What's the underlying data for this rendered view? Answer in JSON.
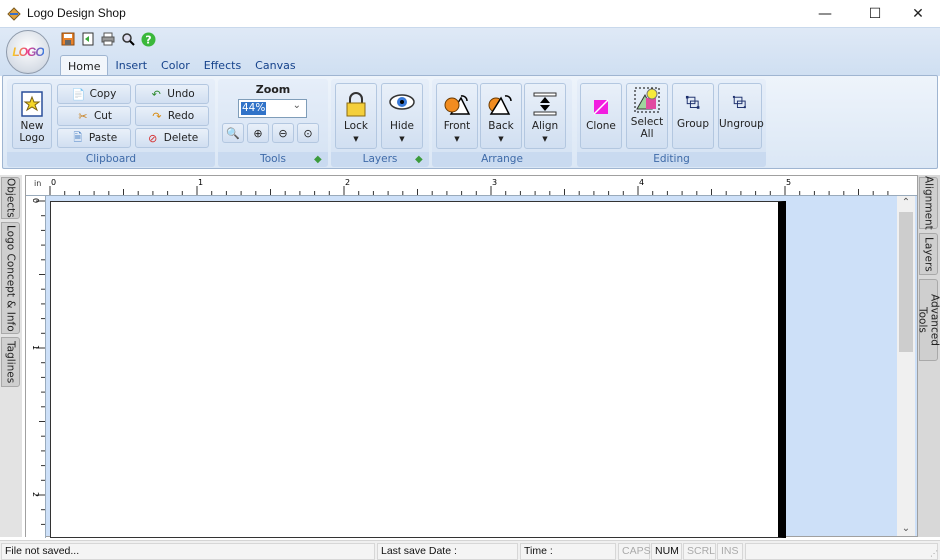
{
  "window": {
    "title": "Logo Design Shop",
    "controls": {
      "minimize": "—",
      "maximize": "☐",
      "close": "✕"
    }
  },
  "app_orb": {
    "label": "LOGO"
  },
  "quick_access": [
    {
      "name": "save-icon",
      "glyph": "💾"
    },
    {
      "name": "export-icon",
      "glyph": "📄"
    },
    {
      "name": "print-icon",
      "glyph": "🖶"
    },
    {
      "name": "preview-icon",
      "glyph": "🔍"
    },
    {
      "name": "help-icon",
      "glyph": "?"
    }
  ],
  "tabs": [
    {
      "label": "Home",
      "active": true
    },
    {
      "label": "Insert"
    },
    {
      "label": "Color"
    },
    {
      "label": "Effects"
    },
    {
      "label": "Canvas"
    }
  ],
  "ribbon": {
    "clipboard": {
      "label": "Clipboard",
      "new_logo": "New\nLogo",
      "copy": "Copy",
      "cut": "Cut",
      "paste": "Paste",
      "undo": "Undo",
      "redo": "Redo",
      "delete": "Delete"
    },
    "tools": {
      "label": "Tools",
      "zoom_title": "Zoom",
      "zoom_value": "44%"
    },
    "layers": {
      "label": "Layers",
      "lock": "Lock",
      "hide": "Hide"
    },
    "arrange": {
      "label": "Arrange",
      "front": "Front",
      "back": "Back",
      "align": "Align"
    },
    "editing": {
      "label": "Editing",
      "clone": "Clone",
      "select_all_1": "Select",
      "select_all_2": "All",
      "group": "Group",
      "ungroup": "Ungroup"
    }
  },
  "left_panel_tabs": [
    "Objects",
    "Logo Concept & Info",
    "Taglines"
  ],
  "right_panel_tabs": [
    "Alignment",
    "Layers",
    "Advanced Tools"
  ],
  "ruler": {
    "unit": "in",
    "h_labels": [
      "0",
      "1",
      "2",
      "3",
      "4",
      "5"
    ],
    "v_labels": [
      "0",
      "1",
      "2"
    ]
  },
  "status": {
    "file": "File not saved...",
    "last_save": "Last save Date :",
    "time": "Time :",
    "caps": "CAPS",
    "num": "NUM",
    "scrl": "SCRL",
    "ins": "INS"
  },
  "colors": {
    "ribbon_bg": "#dbe7f5",
    "canvas_bg": "#cde0f8",
    "accent": "#15428b"
  }
}
